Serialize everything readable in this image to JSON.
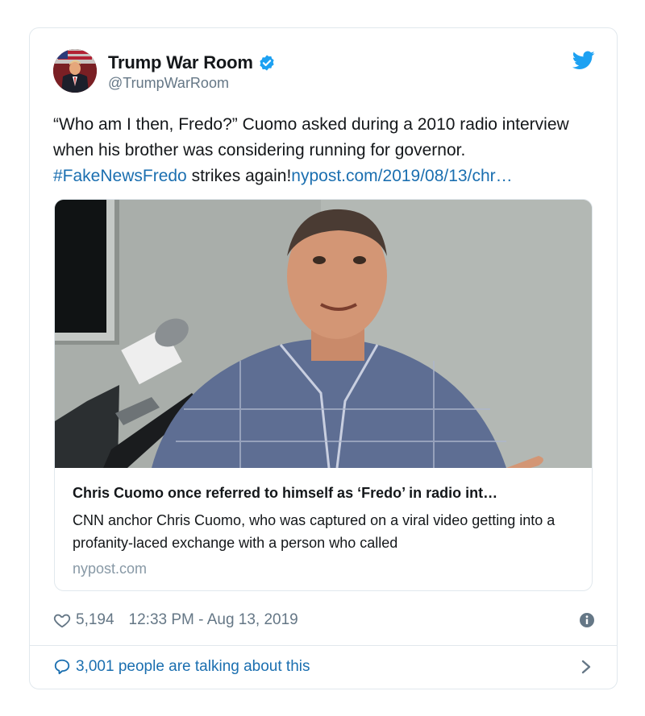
{
  "author": {
    "display_name": "Trump War Room",
    "handle": "@TrumpWarRoom",
    "verified": true
  },
  "tweet": {
    "text_part1": "“Who am I then, Fredo?” Cuomo asked during a 2010 radio interview when his brother was considering running for governor.",
    "hashtag": "#FakeNewsFredo",
    "text_part2": " strikes again!",
    "link_text": "nypost.com/2019/08/13/chr…"
  },
  "link_card": {
    "title": "Chris Cuomo once referred to himself as ‘Fredo’ in radio int…",
    "description": "CNN anchor Chris Cuomo, who was captured on a viral video getting into a profanity-laced exchange with a person who called",
    "domain": "nypost.com"
  },
  "meta": {
    "like_count": "5,194",
    "timestamp": "12:33 PM - Aug 13, 2019"
  },
  "talking": {
    "label": "3,001 people are talking about this"
  },
  "colors": {
    "link": "#1b6fb0",
    "verified": "#1da1f2",
    "muted": "#657786",
    "border": "#e1e8ed"
  },
  "icons": [
    "verified-badge-icon",
    "twitter-bird-icon",
    "heart-icon",
    "info-icon",
    "speech-bubble-icon",
    "chevron-right-icon"
  ]
}
